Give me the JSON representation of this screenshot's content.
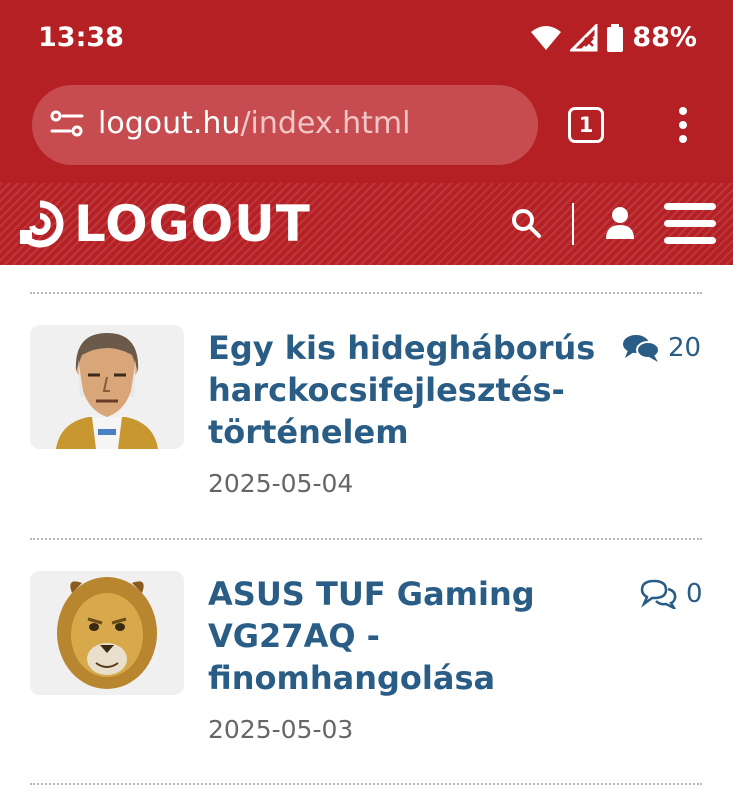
{
  "status_bar": {
    "time": "13:38",
    "battery": "88%",
    "icons": [
      "wifi-icon",
      "cell-signal-icon",
      "battery-icon"
    ]
  },
  "browser": {
    "url_domain": "logout.hu",
    "url_path": "/index.html",
    "tab_count": "1"
  },
  "site": {
    "logo_text": "LOGOUT",
    "accent_color": "#b52025",
    "link_color": "#2a5d86"
  },
  "articles": [
    {
      "title": "Egy kis hidegháborús harckocsifejlesztés-történelem",
      "comments": "20",
      "date": "2025-05-04",
      "avatar": "soldier-avatar",
      "comment_icon": "comments-filled-icon"
    },
    {
      "title": "ASUS TUF Gaming VG27AQ - finomhangolása",
      "comments": "0",
      "date": "2025-05-03",
      "avatar": "lion-avatar",
      "comment_icon": "comments-outline-icon"
    }
  ]
}
